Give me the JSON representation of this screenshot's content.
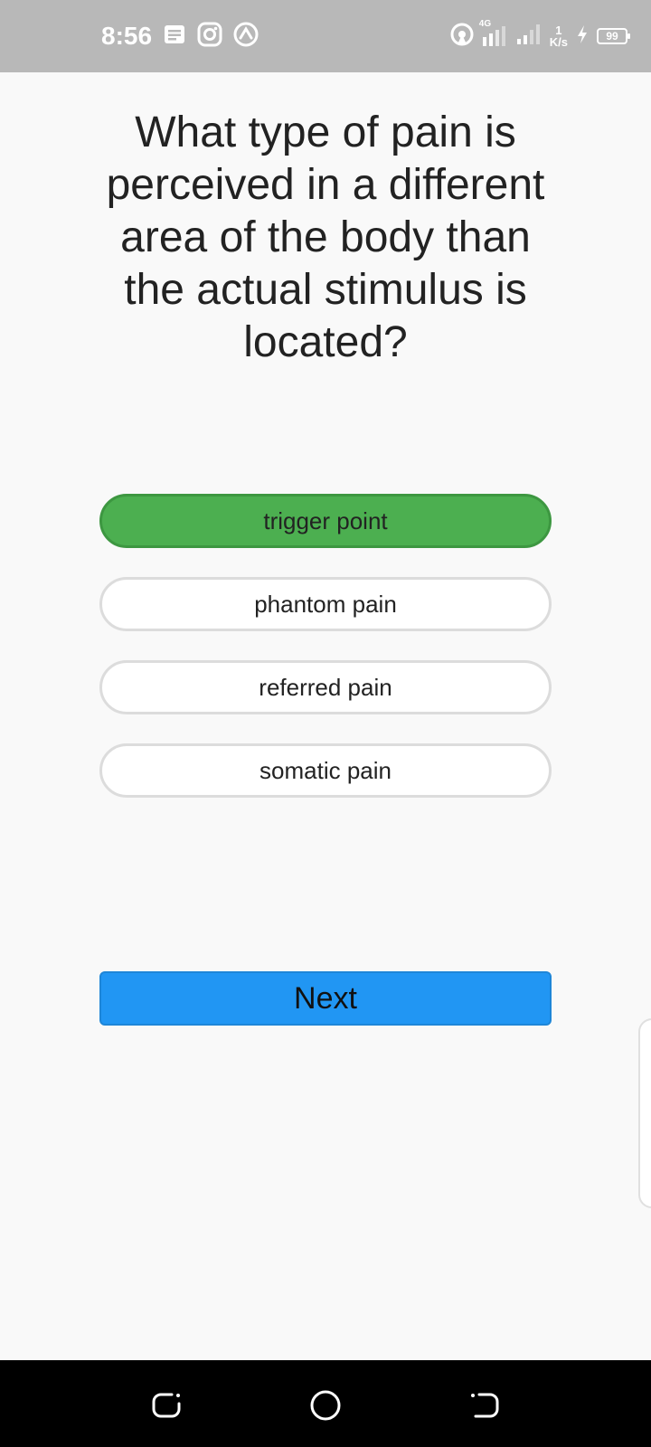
{
  "status_bar": {
    "time": "8:56",
    "network_type": "4G",
    "speed_value": "1",
    "speed_unit": "K/s",
    "battery": "99",
    "left_icons": [
      "notes-icon",
      "instagram-icon",
      "app-icon"
    ],
    "right_icons": [
      "hotspot-icon",
      "signal-icon",
      "signal-icon-2",
      "charging-icon"
    ]
  },
  "quiz": {
    "question": "What type of pain is perceived in a different area of the body than the actual stimulus is located?",
    "options": [
      {
        "label": "trigger point",
        "selected": true
      },
      {
        "label": "phantom pain",
        "selected": false
      },
      {
        "label": "referred pain",
        "selected": false
      },
      {
        "label": "somatic pain",
        "selected": false
      }
    ],
    "next_label": "Next"
  },
  "colors": {
    "selected_option": "#4caf50",
    "next_button": "#2196f3",
    "status_bar": "#b8b8b8",
    "nav_bar": "#000000"
  },
  "nav_bar": {
    "icons": [
      "recent-apps-icon",
      "home-icon",
      "back-icon"
    ]
  }
}
